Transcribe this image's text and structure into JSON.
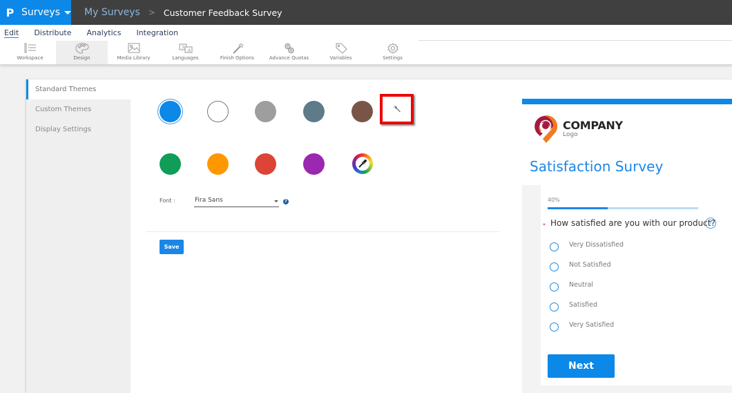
{
  "app": {
    "logo_glyph": "P",
    "name": "Surveys",
    "brand_color": "#0b88e8"
  },
  "breadcrumb": {
    "parent": "My Surveys",
    "separator": ">",
    "current": "Customer Feedback Survey"
  },
  "menu": {
    "items": [
      {
        "label": "Edit",
        "active": true
      },
      {
        "label": "Distribute"
      },
      {
        "label": "Analytics"
      },
      {
        "label": "Integration"
      }
    ]
  },
  "toolbar": {
    "items": [
      {
        "label": "Workspace",
        "icon": "workspace-icon"
      },
      {
        "label": "Design",
        "icon": "palette-icon",
        "active": true
      },
      {
        "label": "Media Library",
        "icon": "image-icon"
      },
      {
        "label": "Languages",
        "icon": "translate-icon"
      },
      {
        "label": "Finish Options",
        "icon": "magic-wand-icon"
      },
      {
        "label": "Advance Quotas",
        "icon": "link-icon"
      },
      {
        "label": "Variables",
        "icon": "tag-icon"
      },
      {
        "label": "Settings",
        "icon": "gear-icon"
      }
    ]
  },
  "sidenav": {
    "items": [
      {
        "label": "Standard Themes",
        "active": true
      },
      {
        "label": "Custom Themes"
      },
      {
        "label": "Display Settings"
      }
    ]
  },
  "themes": {
    "swatches": [
      {
        "name": "blue",
        "color": "#0b88e8",
        "selected": true
      },
      {
        "name": "white",
        "color": "#ffffff"
      },
      {
        "name": "gray",
        "color": "#9e9e9e"
      },
      {
        "name": "slate",
        "color": "#5f7b8a"
      },
      {
        "name": "brown",
        "color": "#795548"
      },
      {
        "name": "green",
        "color": "#0f9d58"
      },
      {
        "name": "orange",
        "color": "#ff9800"
      },
      {
        "name": "red",
        "color": "#db4437"
      },
      {
        "name": "purple",
        "color": "#9c27b0"
      }
    ],
    "custom_icon": "wrench-icon",
    "picker_icon": "color-picker-icon",
    "highlight_color": "#ee0000"
  },
  "font": {
    "label": "Font :",
    "value": "Fira Sans",
    "help": "?"
  },
  "actions": {
    "save": "Save"
  },
  "preview": {
    "company": "COMPANY",
    "logo_sub": "Logo",
    "title": "Satisfaction Survey",
    "progress_label": "40%",
    "progress": 0.4,
    "required_marker": "*",
    "question": "How satisfied are you with our product?",
    "help": "?",
    "options": [
      "Very Dissatisfied",
      "Not Satisfied",
      "Neutral",
      "Satisfied",
      "Very Satisfied"
    ],
    "next": "Next"
  }
}
